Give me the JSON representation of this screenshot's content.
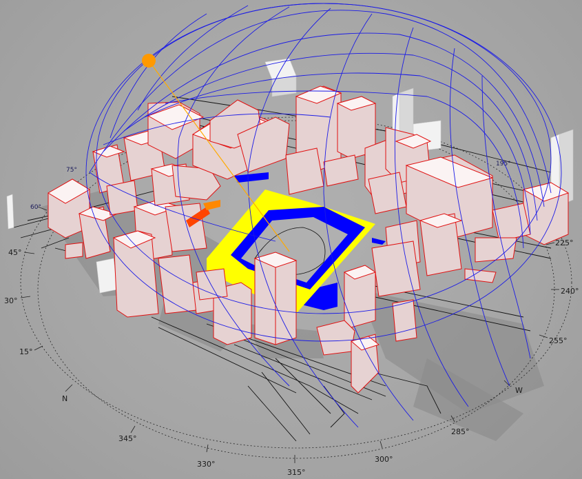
{
  "scene": {
    "sun_color": "#ff9900",
    "sun_ray_color": "#ffaa00",
    "highlight_top_color": "#ffff00",
    "highlight_side_color": "#0000ff",
    "building_edge_color": "#e01010",
    "sun_path_color": "#1a1ae6"
  },
  "compass": {
    "labels": [
      "N",
      "15°",
      "30°",
      "45°",
      "60°",
      "75°",
      "345°",
      "330°",
      "315°",
      "300°",
      "285°",
      "W",
      "255°",
      "240°",
      "225°",
      "195°"
    ]
  },
  "icons": {
    "sun": "sun-icon"
  }
}
